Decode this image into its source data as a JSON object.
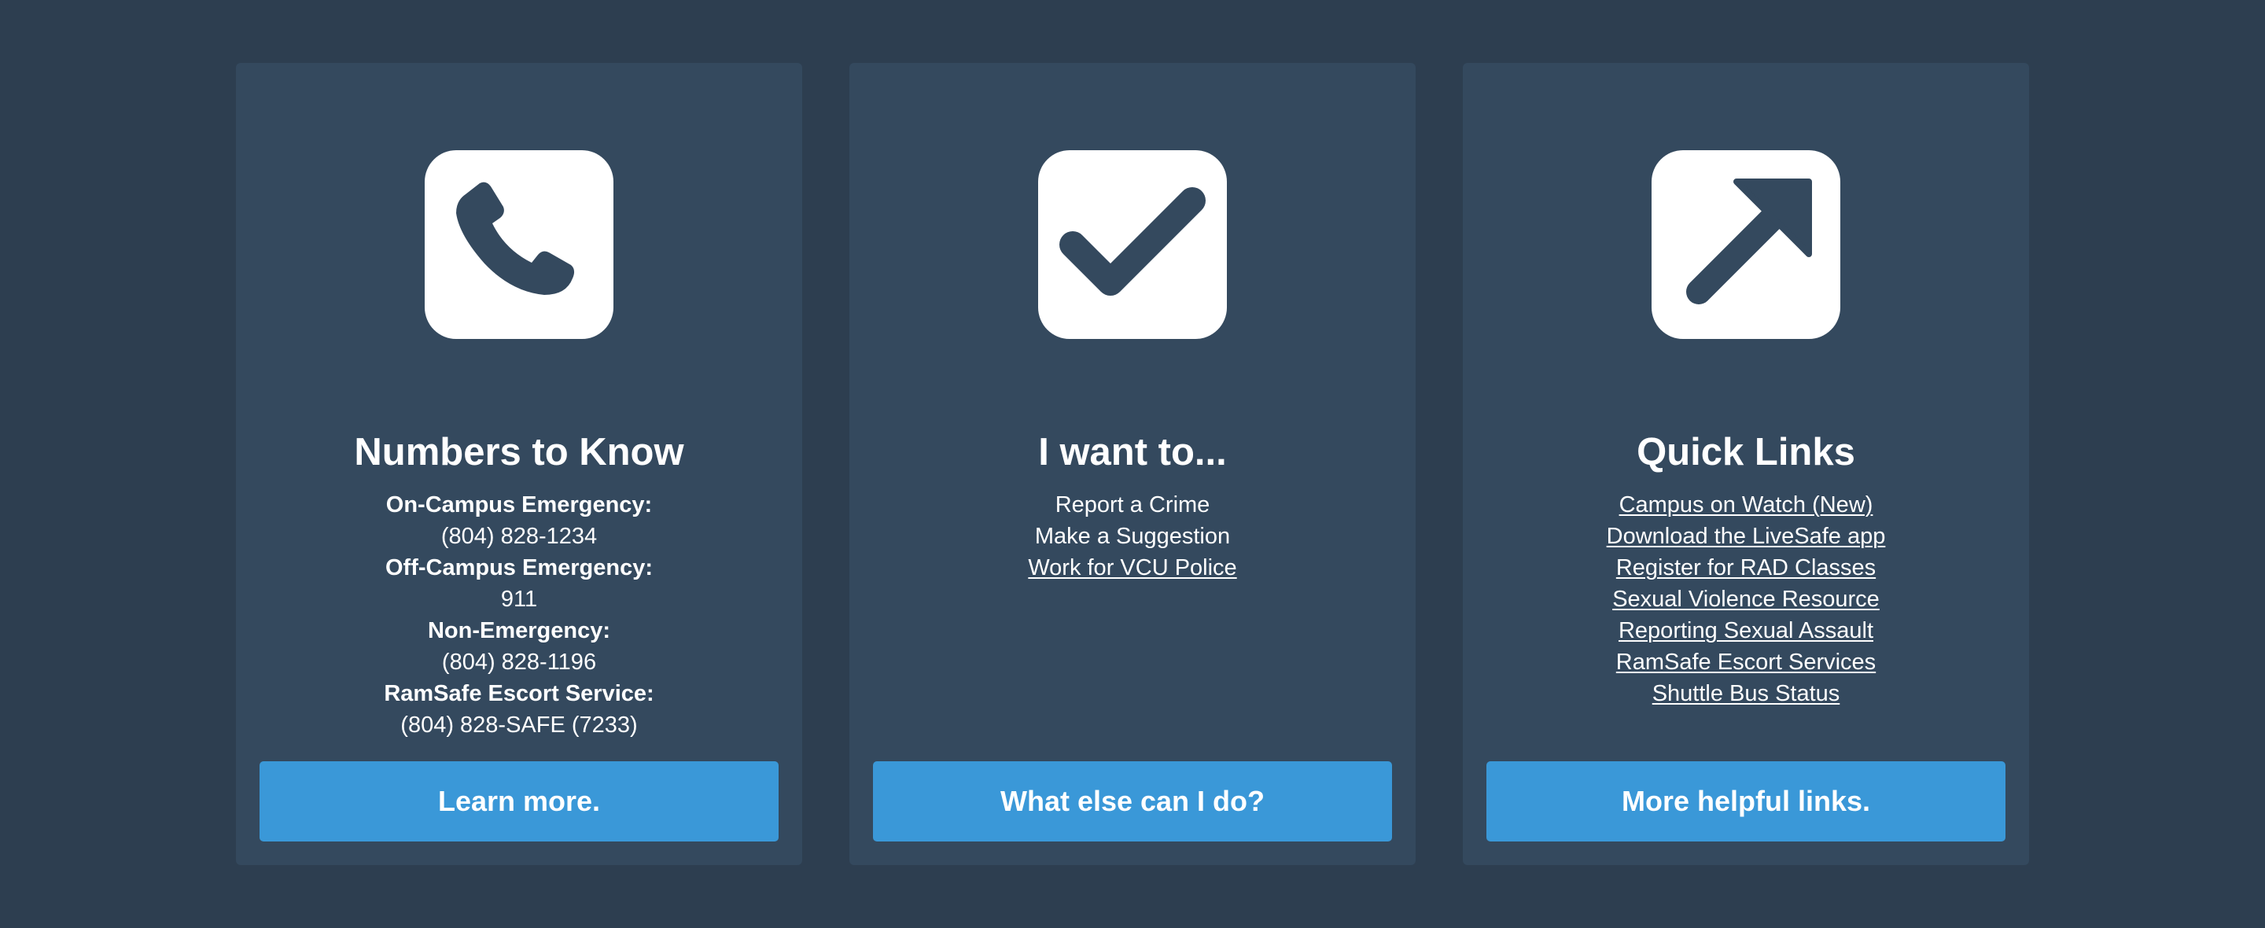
{
  "colors": {
    "page_background": "#2d3e50",
    "card_background": "#34495e",
    "button_background": "#3a98d8",
    "icon_tile": "#ffffff"
  },
  "cards": [
    {
      "icon": "phone-icon",
      "title": "Numbers to Know",
      "entries": [
        {
          "label": "On-Campus Emergency:",
          "value": "(804) 828-1234"
        },
        {
          "label": "Off-Campus Emergency:",
          "value": "911"
        },
        {
          "label": "Non-Emergency:",
          "value": "(804) 828-1196"
        },
        {
          "label": "RamSafe Escort Service:",
          "value": "(804) 828-SAFE (7233)"
        }
      ],
      "button_label": "Learn more."
    },
    {
      "icon": "checkmark-icon",
      "title": "I want to...",
      "items": [
        "Report a Crime",
        "Make a Suggestion"
      ],
      "links": [
        "Work for VCU Police"
      ],
      "button_label": "What else can I do?"
    },
    {
      "icon": "external-link-arrow-icon",
      "title": "Quick Links",
      "links": [
        "Campus on Watch (New)",
        "Download the LiveSafe app",
        "Register for RAD Classes",
        "Sexual Violence Resource",
        "Reporting Sexual Assault",
        "RamSafe Escort Services",
        "Shuttle Bus Status"
      ],
      "button_label": "More helpful links."
    }
  ]
}
